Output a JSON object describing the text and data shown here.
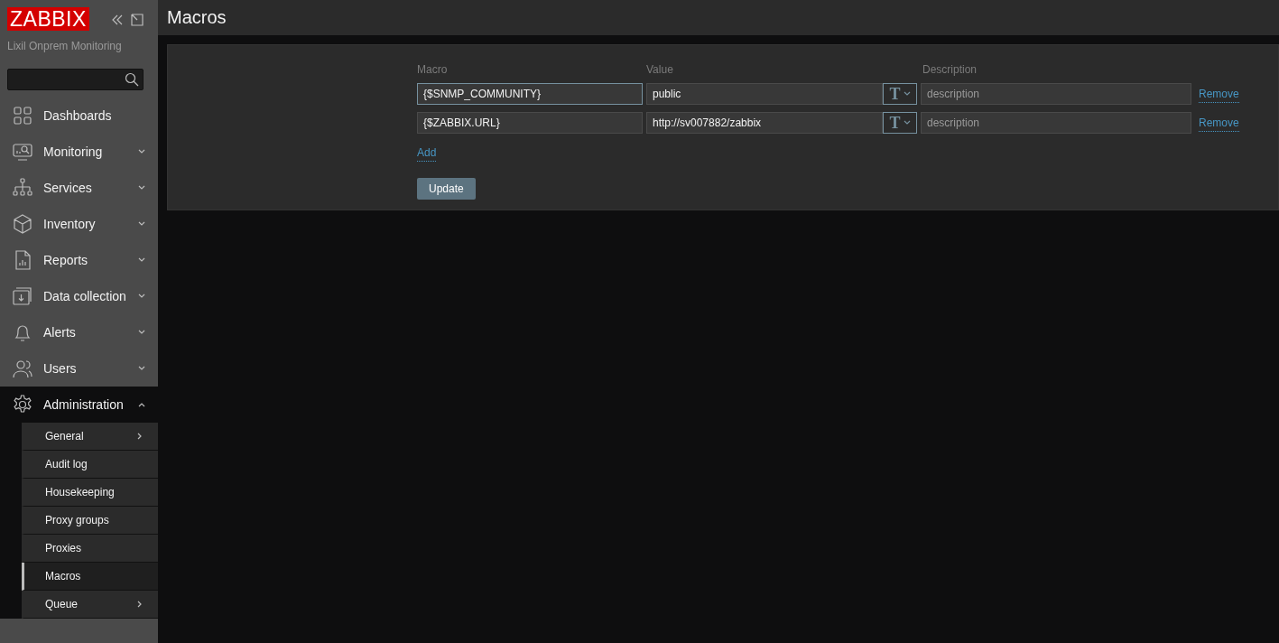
{
  "sidebar": {
    "logo": "ZABBIX",
    "server_name": "Lixil Onprem Monitoring",
    "items": [
      {
        "label": "Dashboards",
        "has_children": false,
        "expanded": false
      },
      {
        "label": "Monitoring",
        "has_children": true,
        "expanded": false
      },
      {
        "label": "Services",
        "has_children": true,
        "expanded": false
      },
      {
        "label": "Inventory",
        "has_children": true,
        "expanded": false
      },
      {
        "label": "Reports",
        "has_children": true,
        "expanded": false
      },
      {
        "label": "Data collection",
        "has_children": true,
        "expanded": false
      },
      {
        "label": "Alerts",
        "has_children": true,
        "expanded": false
      },
      {
        "label": "Users",
        "has_children": true,
        "expanded": false
      },
      {
        "label": "Administration",
        "has_children": true,
        "expanded": true,
        "children": [
          {
            "label": "General",
            "has_children": true,
            "selected": false
          },
          {
            "label": "Audit log",
            "has_children": false,
            "selected": false
          },
          {
            "label": "Housekeeping",
            "has_children": false,
            "selected": false
          },
          {
            "label": "Proxy groups",
            "has_children": false,
            "selected": false
          },
          {
            "label": "Proxies",
            "has_children": false,
            "selected": false
          },
          {
            "label": "Macros",
            "has_children": false,
            "selected": true
          },
          {
            "label": "Queue",
            "has_children": true,
            "selected": false
          }
        ]
      }
    ]
  },
  "page": {
    "title": "Macros"
  },
  "form": {
    "columns": [
      "Macro",
      "Value",
      "Description"
    ],
    "rows": [
      {
        "macro": "{$SNMP_COMMUNITY}",
        "value": "public",
        "description_placeholder": "description",
        "remove": "Remove",
        "focused": true,
        "type_symbol": "T"
      },
      {
        "macro": "{$ZABBIX.URL}",
        "value": "http://sv007882/zabbix",
        "description_placeholder": "description",
        "remove": "Remove",
        "focused": false,
        "type_symbol": "T"
      }
    ],
    "add": "Add",
    "update": "Update"
  }
}
